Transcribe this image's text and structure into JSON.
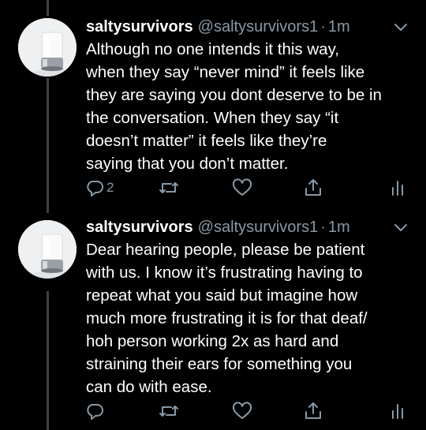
{
  "colors": {
    "background": "#000000",
    "text": "#ffffff",
    "muted": "#8899a6",
    "thread_line": "#3a444c"
  },
  "tweets": [
    {
      "name": "saltysurvivors",
      "handle": "@saltysurvivors1",
      "separator": "·",
      "time": "1m",
      "text": "Although no one intends it this way,\nwhen they say “never mind” it feels like\nthey are saying you dont deserve to be in\nthe conversation. When they say “it\ndoesn’t matter” it feels like they’re\nsaying that you don’t matter.",
      "actions": {
        "reply_icon": "reply-icon",
        "reply_count": "2",
        "retweet_icon": "retweet-icon",
        "like_icon": "heart-icon",
        "share_icon": "share-icon",
        "analytics_icon": "analytics-icon"
      }
    },
    {
      "name": "saltysurvivors",
      "handle": "@saltysurvivors1",
      "separator": "·",
      "time": "1m",
      "text": "Dear hearing people, please be patient\nwith us. I know it’s frustrating having to\nrepeat what you said but imagine how\nmuch more frustrating it is for that deaf/\nhoh person working 2x as hard and\nstraining their ears for something you\ncan do with ease.",
      "actions": {
        "reply_icon": "reply-icon",
        "reply_count": "",
        "retweet_icon": "retweet-icon",
        "like_icon": "heart-icon",
        "share_icon": "share-icon",
        "analytics_icon": "analytics-icon"
      }
    }
  ]
}
